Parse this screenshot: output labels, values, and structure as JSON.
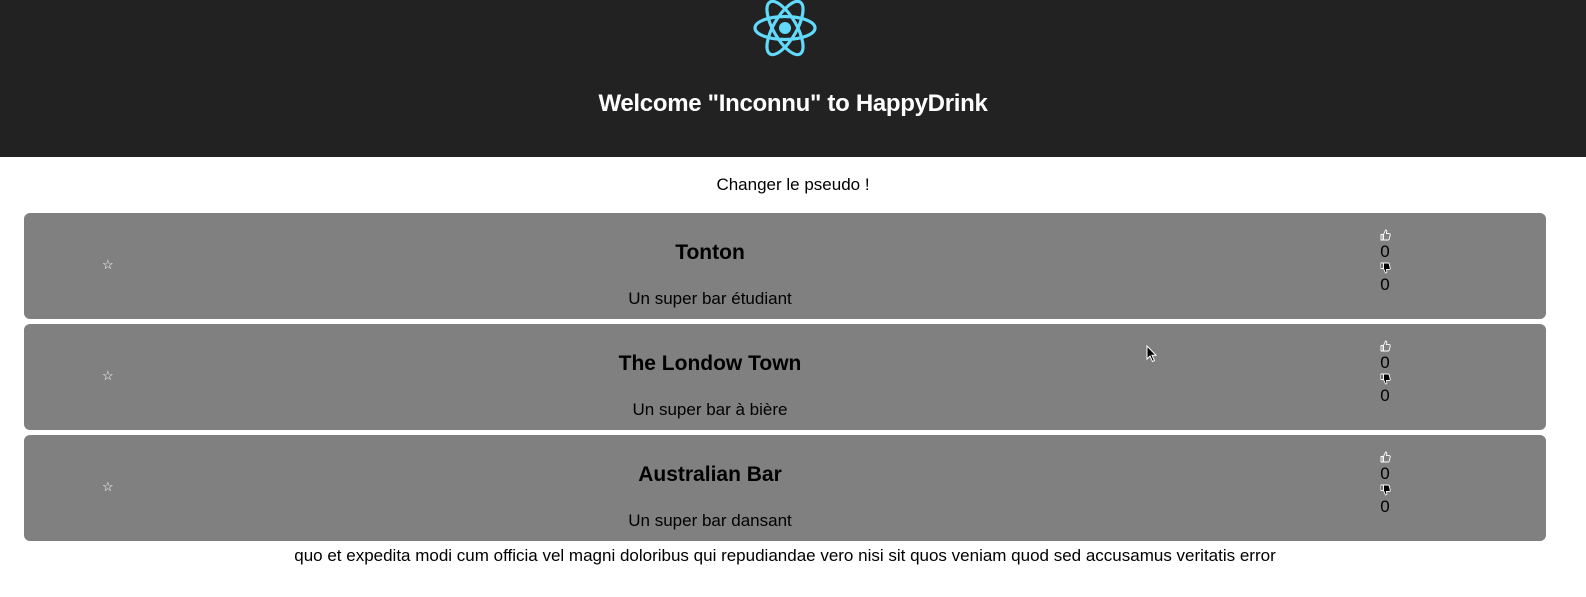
{
  "header": {
    "title": "Welcome \"Inconnu\" to HappyDrink",
    "logo_icon": "react-atom-icon",
    "background": "#222222",
    "logo_color": "#61dafb"
  },
  "change_pseudo": {
    "label": "Changer le pseudo !"
  },
  "bars": [
    {
      "name": "Tonton",
      "description": "Un super bar étudiant",
      "favorite_icon": "star-outline-icon",
      "likes": "0",
      "dislikes": "0"
    },
    {
      "name": "The Londow Town",
      "description": "Un super bar à bière",
      "favorite_icon": "star-outline-icon",
      "likes": "0",
      "dislikes": "0"
    },
    {
      "name": "Australian Bar",
      "description": "Un super bar dansant",
      "favorite_icon": "star-outline-icon",
      "likes": "0",
      "dislikes": "0"
    }
  ],
  "icons": {
    "like": "thumbs-up-icon",
    "dislike": "thumbs-down-icon"
  },
  "card_color": "#808080",
  "footer": {
    "text": "quo et expedita modi cum officia vel magni doloribus qui repudiandae vero nisi sit quos veniam quod sed accusamus veritatis error"
  }
}
